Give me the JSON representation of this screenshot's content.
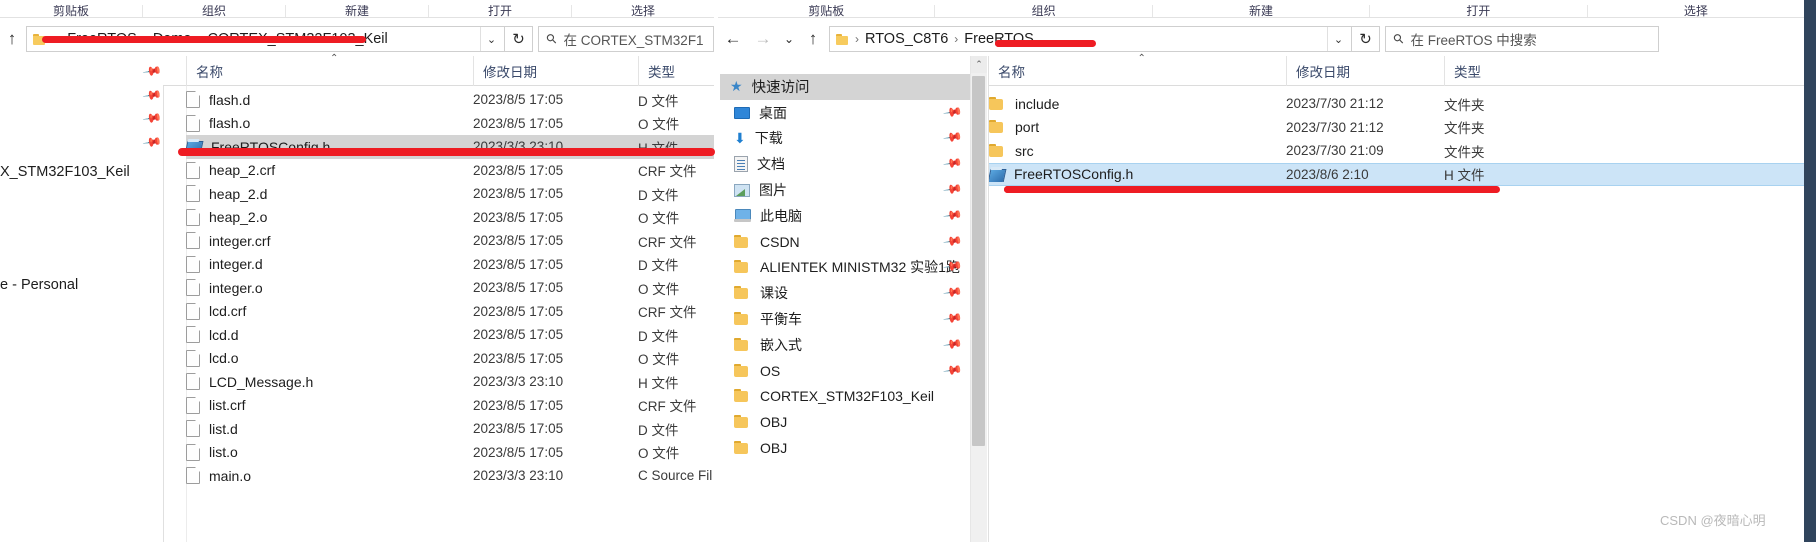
{
  "left_window": {
    "ribbon_groups": [
      "剪贴板",
      "组织",
      "新建",
      "打开",
      "选择"
    ],
    "nav": {
      "up_icon": "↑",
      "folder_icon": "folder-icon",
      "overflow": "«",
      "breadcrumbs": [
        "FreeRTOS",
        "Demo",
        "CORTEX_STM32F103_Keil"
      ],
      "dropdown_icon": "⌄",
      "refresh_icon": "↻"
    },
    "search": {
      "icon": "search-icon",
      "placeholder": "在 CORTEX_STM32F1"
    },
    "columns": [
      "名称",
      "修改日期",
      "类型"
    ],
    "sort_caret": "⌃",
    "files": [
      {
        "name": "flash.d",
        "icon": "file-icon",
        "date": "2023/8/5 17:05",
        "type": "D 文件"
      },
      {
        "name": "flash.o",
        "icon": "file-icon",
        "date": "2023/8/5 17:05",
        "type": "O 文件"
      },
      {
        "name": "FreeRTOSConfig.h",
        "icon": "header-icon",
        "date": "2023/3/3 23:10",
        "type": "H 文件",
        "selected": true
      },
      {
        "name": "heap_2.crf",
        "icon": "file-icon",
        "date": "2023/8/5 17:05",
        "type": "CRF 文件"
      },
      {
        "name": "heap_2.d",
        "icon": "file-icon",
        "date": "2023/8/5 17:05",
        "type": "D 文件"
      },
      {
        "name": "heap_2.o",
        "icon": "file-icon",
        "date": "2023/8/5 17:05",
        "type": "O 文件"
      },
      {
        "name": "integer.crf",
        "icon": "file-icon",
        "date": "2023/8/5 17:05",
        "type": "CRF 文件"
      },
      {
        "name": "integer.d",
        "icon": "file-icon",
        "date": "2023/8/5 17:05",
        "type": "D 文件"
      },
      {
        "name": "integer.o",
        "icon": "file-icon",
        "date": "2023/8/5 17:05",
        "type": "O 文件"
      },
      {
        "name": "lcd.crf",
        "icon": "file-icon",
        "date": "2023/8/5 17:05",
        "type": "CRF 文件"
      },
      {
        "name": "lcd.d",
        "icon": "file-icon",
        "date": "2023/8/5 17:05",
        "type": "D 文件"
      },
      {
        "name": "lcd.o",
        "icon": "file-icon",
        "date": "2023/8/5 17:05",
        "type": "O 文件"
      },
      {
        "name": "LCD_Message.h",
        "icon": "file-icon",
        "date": "2023/3/3 23:10",
        "type": "H 文件"
      },
      {
        "name": "list.crf",
        "icon": "file-icon",
        "date": "2023/8/5 17:05",
        "type": "CRF 文件"
      },
      {
        "name": "list.d",
        "icon": "file-icon",
        "date": "2023/8/5 17:05",
        "type": "D 文件"
      },
      {
        "name": "list.o",
        "icon": "file-icon",
        "date": "2023/8/5 17:05",
        "type": "O 文件"
      },
      {
        "name": "main.o",
        "icon": "file-icon",
        "date": "2023/3/3 23:10",
        "type": "C Source Fil"
      }
    ]
  },
  "background_window": {
    "path_fragment": "X_STM32F103_Keil",
    "personal_fragment": "e - Personal"
  },
  "right_window": {
    "ribbon_groups": [
      "剪贴板",
      "组织",
      "新建",
      "打开",
      "选择"
    ],
    "nav": {
      "back_icon": "←",
      "forward_icon": "→",
      "history_icon": "⌄",
      "up_icon": "↑",
      "folder_icon": "folder-icon",
      "breadcrumbs": [
        "RTOS_C8T6",
        "FreeRTOS"
      ],
      "dropdown_icon": "⌄",
      "refresh_icon": "↻"
    },
    "search": {
      "icon": "search-icon",
      "placeholder": "在 FreeRTOS 中搜索"
    },
    "quick_access": {
      "header": "快速访问",
      "header_icon": "star-pin-icon",
      "items": [
        {
          "label": "桌面",
          "icon": "desktop-icon",
          "pinned": true
        },
        {
          "label": "下载",
          "icon": "download-icon",
          "pinned": true
        },
        {
          "label": "文档",
          "icon": "document-icon",
          "pinned": true
        },
        {
          "label": "图片",
          "icon": "pictures-icon",
          "pinned": true
        },
        {
          "label": "此电脑",
          "icon": "this-pc-icon",
          "pinned": true
        },
        {
          "label": "CSDN",
          "icon": "folder-icon",
          "pinned": true
        },
        {
          "label": "ALIENTEK MINISTM32 实验1跑",
          "icon": "folder-icon",
          "pinned": true
        },
        {
          "label": "课设",
          "icon": "folder-icon",
          "pinned": true
        },
        {
          "label": "平衡车",
          "icon": "folder-icon",
          "pinned": true
        },
        {
          "label": "嵌入式",
          "icon": "folder-icon",
          "pinned": true
        },
        {
          "label": "OS",
          "icon": "folder-icon",
          "pinned": true
        },
        {
          "label": "CORTEX_STM32F103_Keil",
          "icon": "folder-icon",
          "pinned": false
        },
        {
          "label": "OBJ",
          "icon": "folder-icon",
          "pinned": false
        },
        {
          "label": "OBJ",
          "icon": "folder-icon",
          "pinned": false
        }
      ]
    },
    "columns": [
      "名称",
      "修改日期",
      "类型"
    ],
    "sort_caret": "⌃",
    "files": [
      {
        "name": "include",
        "icon": "folder-icon",
        "date": "2023/7/30 21:12",
        "type": "文件夹"
      },
      {
        "name": "port",
        "icon": "folder-icon",
        "date": "2023/7/30 21:12",
        "type": "文件夹"
      },
      {
        "name": "src",
        "icon": "folder-icon",
        "date": "2023/7/30 21:09",
        "type": "文件夹"
      },
      {
        "name": "FreeRTOSConfig.h",
        "icon": "header-icon",
        "date": "2023/8/6 2:10",
        "type": "H 文件",
        "selected": true
      }
    ]
  },
  "annotations": {
    "color": "#ee1c23",
    "bars": [
      {
        "name": "left-breadcrumb-underline"
      },
      {
        "name": "left-selected-file-underline"
      },
      {
        "name": "right-breadcrumb-underline"
      },
      {
        "name": "right-selected-file-underline"
      }
    ]
  },
  "watermark": "CSDN @夜暗心明"
}
